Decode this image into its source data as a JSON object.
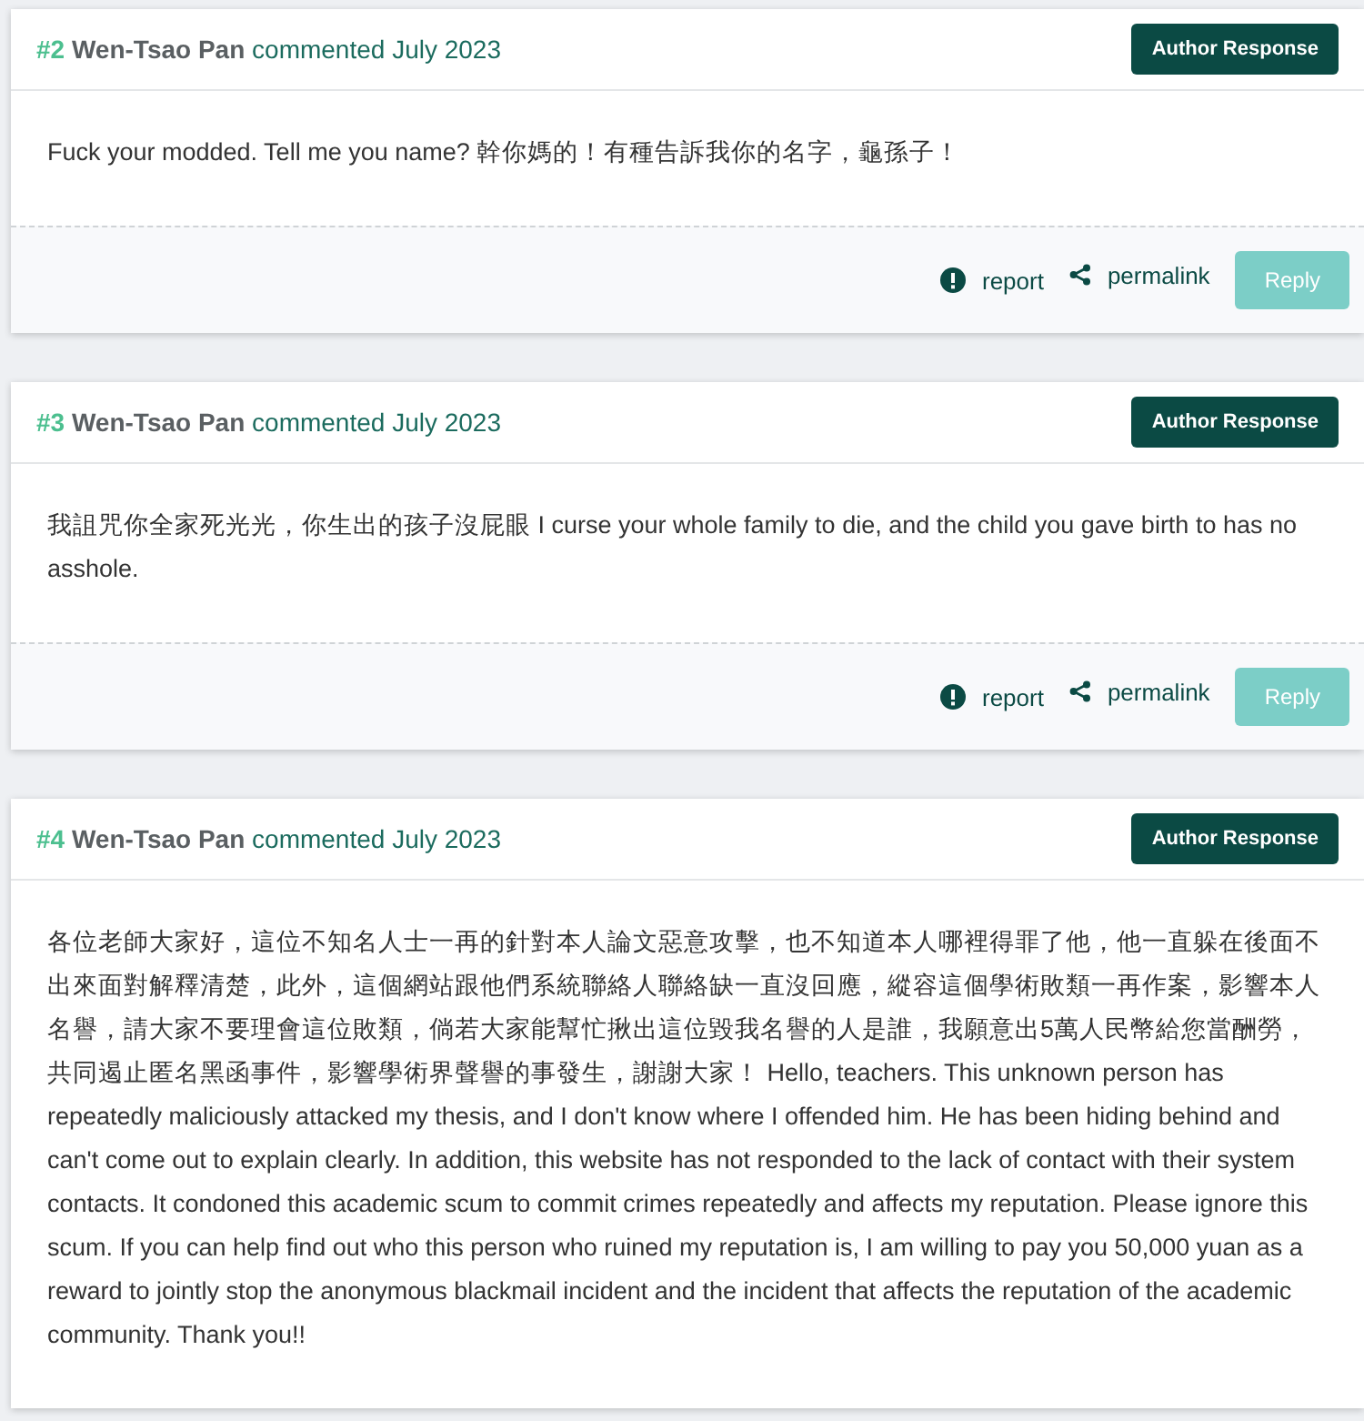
{
  "comments": [
    {
      "number": "#2",
      "author": "Wen-Tsao Pan",
      "meta": "commented July 2023",
      "badge": "Author Response",
      "body": "Fuck your modded. Tell me you name? 幹你媽的！有種告訴我你的名字，龜孫子！",
      "footer": {
        "report": "report",
        "permalink": "permalink",
        "reply": {
          "label": "Reply",
          "disabled": true
        }
      }
    },
    {
      "number": "#3",
      "author": "Wen-Tsao Pan",
      "meta": "commented July 2023",
      "badge": "Author Response",
      "body": "我詛咒你全家死光光，你生出的孩子沒屁眼 I curse your whole family to die, and the child you gave birth to has no asshole.",
      "footer": {
        "report": "report",
        "permalink": "permalink",
        "reply": {
          "label": "Reply",
          "disabled": true
        }
      }
    },
    {
      "number": "#4",
      "author": "Wen-Tsao Pan",
      "meta": "commented July 2023",
      "badge": "Author Response",
      "body": "各位老師大家好，這位不知名人士一再的針對本人論文惡意攻擊，也不知道本人哪裡得罪了他，他一直躲在後面不出來面對解釋清楚，此外，這個網站跟他們系統聯絡人聯絡缺一直沒回應，縱容這個學術敗類一再作案，影響本人名譽，請大家不要理會這位敗類，倘若大家能幫忙揪出這位毀我名譽的人是誰，我願意出5萬人民幣給您當酬勞，共同遏止匿名黑函事件，影響學術界聲譽的事發生，謝謝大家！ Hello, teachers. This unknown person has repeatedly maliciously attacked my thesis, and I don't know where I offended him. He has been hiding behind and can't come out to explain clearly. In addition, this website has not responded to the lack of contact with their system contacts. It condoned this academic scum to commit crimes repeatedly and affects my reputation. Please ignore this scum. If you can help find out who this person who ruined my reputation is, I am willing to pay you 50,000 yuan as a reward to jointly stop the anonymous blackmail incident and the incident that affects the reputation of the academic community. Thank you!!"
    }
  ]
}
